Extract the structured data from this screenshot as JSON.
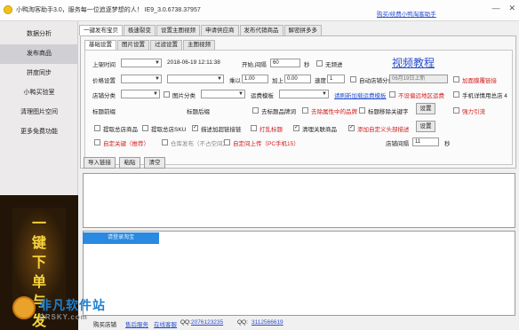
{
  "window": {
    "title": "小鸭淘客助手3.0，服务每一位追逐梦想的人！ IE9_3.0.6738.37957",
    "top_link": "购买/续费小鸭淘客助手",
    "minimize_glyph": "—",
    "close_glyph": "✕"
  },
  "sidebar": {
    "items": [
      {
        "label": "数据分析"
      },
      {
        "label": "发布商品"
      },
      {
        "label": "拼度同步"
      },
      {
        "label": "小鸭买验室"
      },
      {
        "label": "清理图片空间"
      },
      {
        "label": "更多免费功能"
      }
    ],
    "active_index": 1,
    "promo_text": "一键下单与发"
  },
  "tabs": [
    "一键发布宝贝",
    "极速裂变",
    "设置主图视频",
    "申请供应商",
    "发布代销商品",
    "解密拼多多"
  ],
  "subtabs": [
    "基础设置",
    "图片设置",
    "过滤设置",
    "主图视频"
  ],
  "form": {
    "video_link": "视频教程",
    "row1": {
      "label_time": "上架时间",
      "datetime": "2018-06-19 12:11:38",
      "start_label": "开始,间隔",
      "interval": "60",
      "seconds": "秒",
      "no_interval": "无频进"
    },
    "row2": {
      "label_price": "价格设置",
      "mult_label": "乘以",
      "mult_value": "1.00",
      "add_label": "加上",
      "add_value": "0.00",
      "speed_label": "速度",
      "speed_value": "1",
      "auto_shop_label": "自动店铺分类",
      "auto_shop_value": "06月19日上新",
      "add_cover": "加面膜覆链接"
    },
    "row3": {
      "label_shop_cat": "店铺分类",
      "label_img_space": "图片分类",
      "label_freight": "运费模板",
      "refresh_link": "请刷新加载运费模板",
      "no_return": "不设偏远地区运费",
      "phone_detail": "手机详情用总店 4"
    },
    "row4": {
      "label_prefix": "标题前缀",
      "label_suffix": "标题后缀",
      "remove_brand": "去标题品牌词",
      "remove_hidden": "去除属性中的品牌",
      "title_keyword": "标题移除关键字",
      "setting_btn": "设置",
      "delay_convert": "强力引流"
    },
    "row5": {
      "fetch_shop_goods": "提取总店商品",
      "fetch_shop_sku": "提取总店SKU",
      "desc_add_link": "描述加超链接链",
      "mark_title": "打乱标题",
      "clear_related": "清理关联商品",
      "add_custom_head": "添加自定义头部描述",
      "setting_btn": "设置"
    },
    "row6": {
      "auto_upload": "自定关键（推荐）",
      "store_publish": "仓库发布（不占空间）",
      "all_upload": "自定间上传（PC手机15）",
      "store_interval": "店铺间隔",
      "store_interval_value": "11",
      "seconds": "秒"
    }
  },
  "actions": {
    "import_link": "导入链接",
    "paste": "粘贴",
    "clear": "清空"
  },
  "progress": {
    "label": "请登录淘宝"
  },
  "footer": {
    "buy_label": "购买店铺",
    "contact_label": "售后服务",
    "author_label": "在线客服",
    "qq_label1": "QQ:",
    "qq1": "2076123235",
    "qq_label2": "QQ:",
    "qq2": "3112566619"
  },
  "watermark": {
    "text": "非凡软件站",
    "sub": "CRSKY.com"
  }
}
